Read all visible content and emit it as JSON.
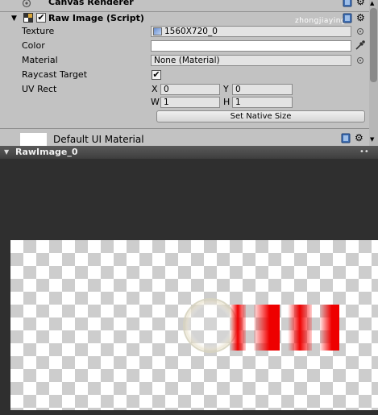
{
  "canvas_renderer": {
    "title": "Canvas Renderer"
  },
  "raw_image": {
    "title": "Raw Image (Script)",
    "enabled": true,
    "texture_label": "Texture",
    "texture_value": "1560X720_0",
    "color_label": "Color",
    "material_label": "Material",
    "material_value": "None (Material)",
    "raycast_label": "Raycast Target",
    "raycast_checked": true,
    "uv_label": "UV Rect",
    "uv_x_label": "X",
    "uv_x": "0",
    "uv_y_label": "Y",
    "uv_y": "0",
    "uv_w_label": "W",
    "uv_w": "1",
    "uv_h_label": "H",
    "uv_h": "1",
    "native_size_button": "Set Native Size"
  },
  "material_preview": {
    "name": "Default UI Material"
  },
  "preview": {
    "title": "RawImage_0"
  },
  "watermark": "zhongjiaying",
  "icons": {
    "book": "help-book-icon",
    "gear": "settings-gear-icon",
    "target": "object-picker-icon",
    "eyedropper": "eyedropper-icon"
  },
  "colors": {
    "inspector_bg": "#c2c2c2",
    "dark_preview": "#2f2f2f",
    "accent_red": "#ee0000",
    "help_blue": "#3f6fb5"
  }
}
